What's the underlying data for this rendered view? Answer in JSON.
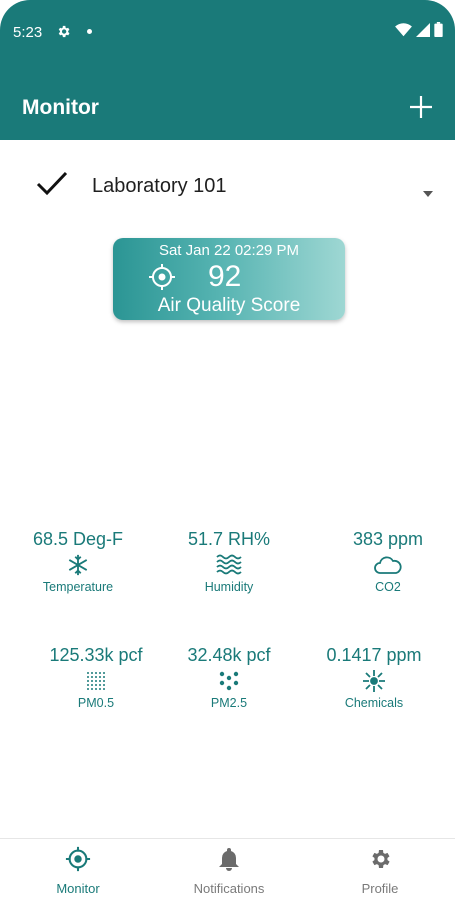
{
  "status_bar": {
    "time": "5:23"
  },
  "app_bar": {
    "title": "Monitor"
  },
  "location": {
    "name": "Laboratory 101"
  },
  "score": {
    "datetime": "Sat Jan 22 02:29 PM",
    "value": "92",
    "label": "Air Quality Score"
  },
  "metrics": [
    {
      "value": "68.5 Deg-F",
      "label": "Temperature",
      "icon": "snowflake-icon"
    },
    {
      "value": "51.7 RH%",
      "label": "Humidity",
      "icon": "waves-icon"
    },
    {
      "value": "383 ppm",
      "label": "CO2",
      "icon": "cloud-icon"
    },
    {
      "value": "125.33k pcf",
      "label": "PM0.5",
      "icon": "fine-dots-icon"
    },
    {
      "value": "32.48k pcf",
      "label": "PM2.5",
      "icon": "coarse-dots-icon"
    },
    {
      "value": "0.1417 ppm",
      "label": "Chemicals",
      "icon": "sparkle-icon"
    }
  ],
  "bottom_nav": [
    {
      "label": "Monitor",
      "icon": "target-icon",
      "active": true
    },
    {
      "label": "Notifications",
      "icon": "bell-icon",
      "active": false
    },
    {
      "label": "Profile",
      "icon": "gear-icon",
      "active": false
    }
  ],
  "colors": {
    "primary": "#1a7a79",
    "card_start": "#2b9594",
    "card_end": "#9ed7d3"
  }
}
